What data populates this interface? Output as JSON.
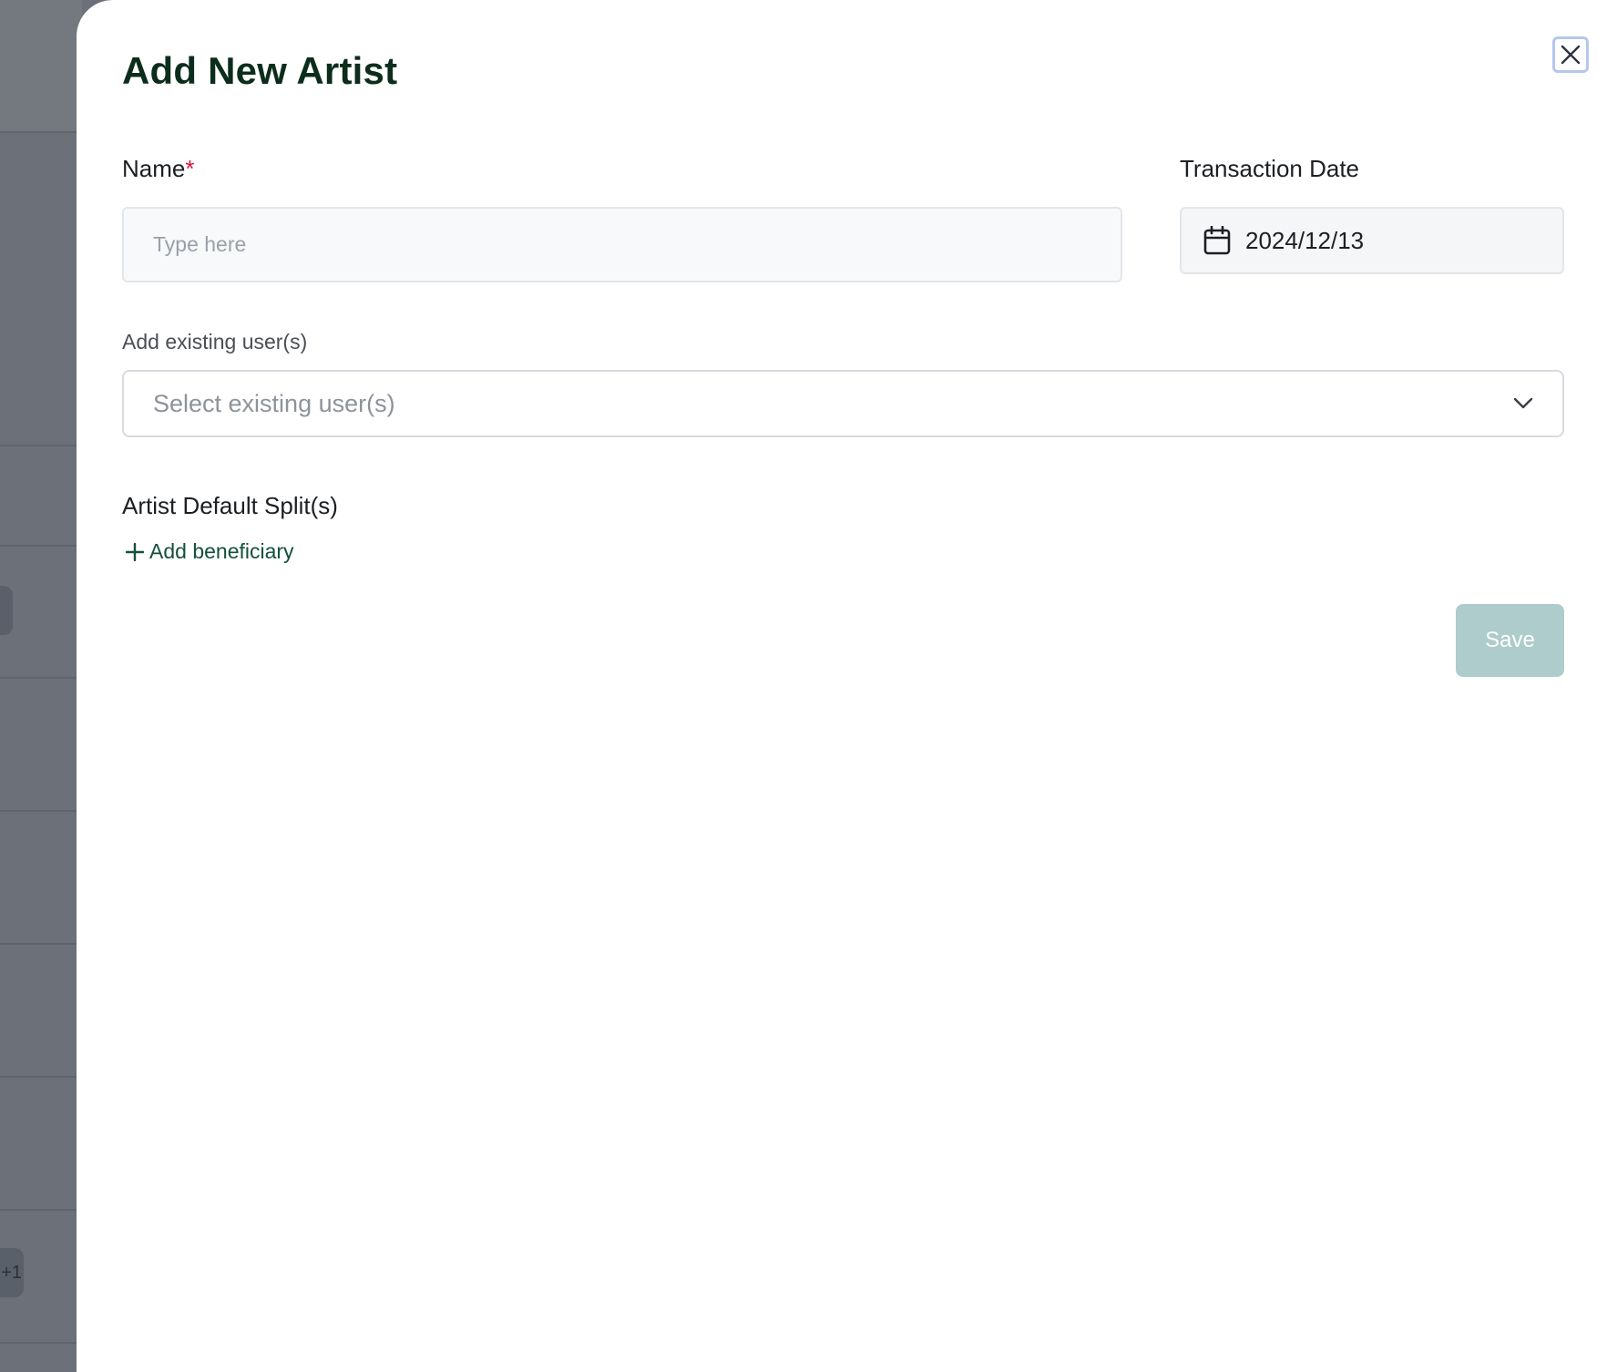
{
  "background": {
    "chip_labels": [
      "",
      "+1"
    ]
  },
  "modal": {
    "title": "Add New Artist",
    "close_icon": "close-icon"
  },
  "form": {
    "name_label": "Name",
    "name_required_mark": "*",
    "name_placeholder": "Type here",
    "name_value": "",
    "transaction_date_label": "Transaction Date",
    "transaction_date_value": "2024/12/13",
    "transaction_date_icon": "calendar-icon",
    "existing_users_label": "Add existing user(s)",
    "existing_users_placeholder": "Select existing user(s)",
    "existing_users_icon": "chevron-down-icon",
    "splits_label": "Artist Default Split(s)",
    "add_beneficiary_label": "Add beneficiary",
    "add_beneficiary_icon": "plus-icon",
    "save_label": "Save"
  },
  "colors": {
    "title": "#0d2d1c",
    "link": "#14503a",
    "save_disabled": "#adcccb",
    "required": "#d7193c",
    "overlay": "#6b7079"
  }
}
